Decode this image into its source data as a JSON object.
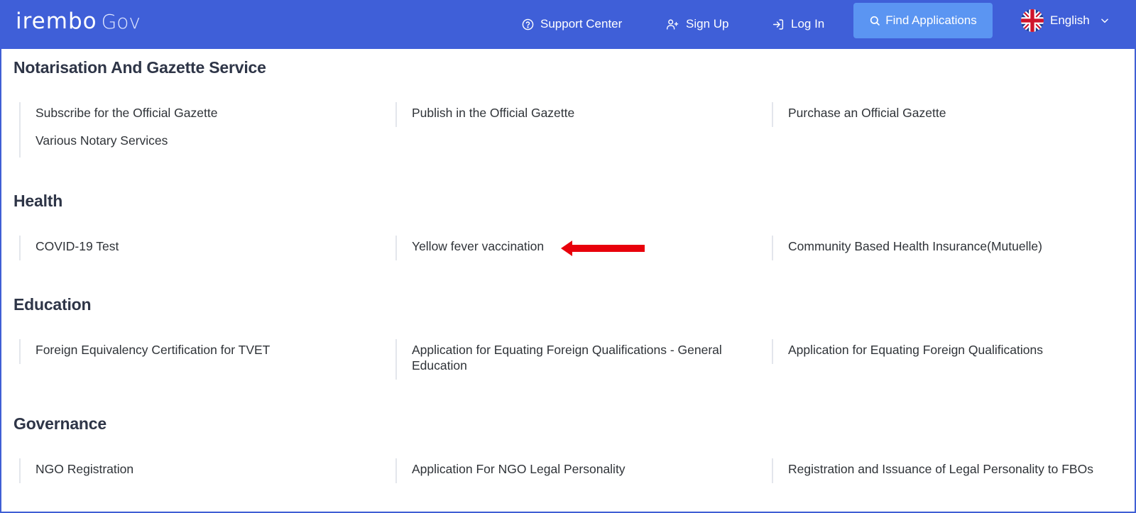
{
  "header": {
    "logo_brand": "irembo",
    "logo_gov": "Gov",
    "support_label": "Support Center",
    "signup_label": "Sign Up",
    "login_label": "Log In",
    "find_label": "Find Applications",
    "language": "English"
  },
  "sections": [
    {
      "title": "Notarisation And Gazette Service",
      "items": [
        "Subscribe for the Official Gazette",
        "Publish in the Official Gazette",
        "Purchase an Official Gazette",
        "Various Notary Services"
      ]
    },
    {
      "title": "Health",
      "items": [
        "COVID-19 Test",
        "Yellow fever vaccination",
        "Community Based Health Insurance(Mutuelle)"
      ]
    },
    {
      "title": "Education",
      "items": [
        "Foreign Equivalency Certification for TVET",
        "Application for Equating Foreign Qualifications - General Education",
        "Application for Equating Foreign Qualifications"
      ]
    },
    {
      "title": "Governance",
      "items": [
        "NGO Registration",
        "Application For NGO Legal Personality",
        "Registration and Issuance of Legal Personality to FBOs"
      ]
    }
  ],
  "colors": {
    "header_bg": "#3f5fd8",
    "find_button_bg": "#5b95f2",
    "annotation_arrow": "#e8000b"
  },
  "icons": [
    "help-circle-icon",
    "add-user-icon",
    "login-icon",
    "search-icon",
    "uk-flag-icon",
    "chevron-down-icon",
    "red-arrow-annotation"
  ]
}
